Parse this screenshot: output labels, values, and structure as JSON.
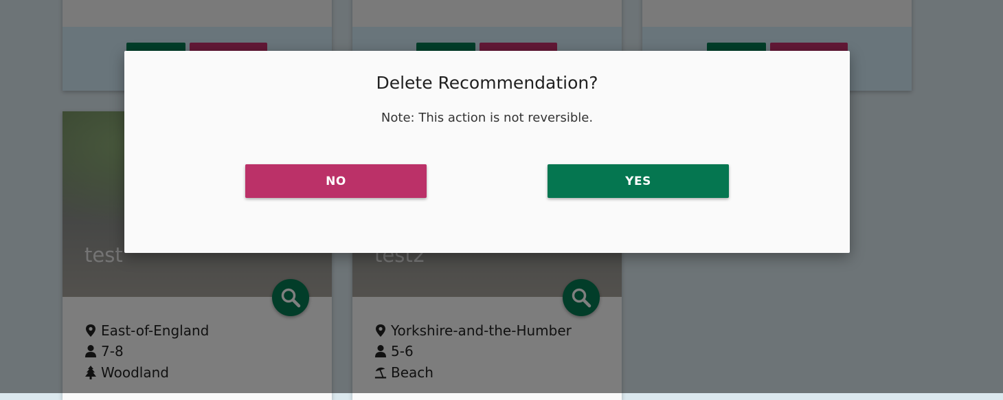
{
  "cards_top": [
    {
      "name": "card-top-1"
    },
    {
      "name": "card-top-2"
    },
    {
      "name": "card-top-3"
    }
  ],
  "cards": [
    {
      "title": "test",
      "location": "East-of-England",
      "age": "7-8",
      "environment": "Woodland",
      "environment_icon": "tree-icon"
    },
    {
      "title": "test2",
      "location": "Yorkshire-and-the-Humber",
      "age": "5-6",
      "environment": "Beach",
      "environment_icon": "beach-umbrella-icon"
    }
  ],
  "dialog": {
    "title": "Delete Recommendation?",
    "note": "Note: This action is not reversible.",
    "no_label": "NO",
    "yes_label": "YES"
  },
  "colors": {
    "primary_green": "#057650",
    "danger_pink": "#bb3168",
    "card_action_bg": "#d3eaf6"
  }
}
